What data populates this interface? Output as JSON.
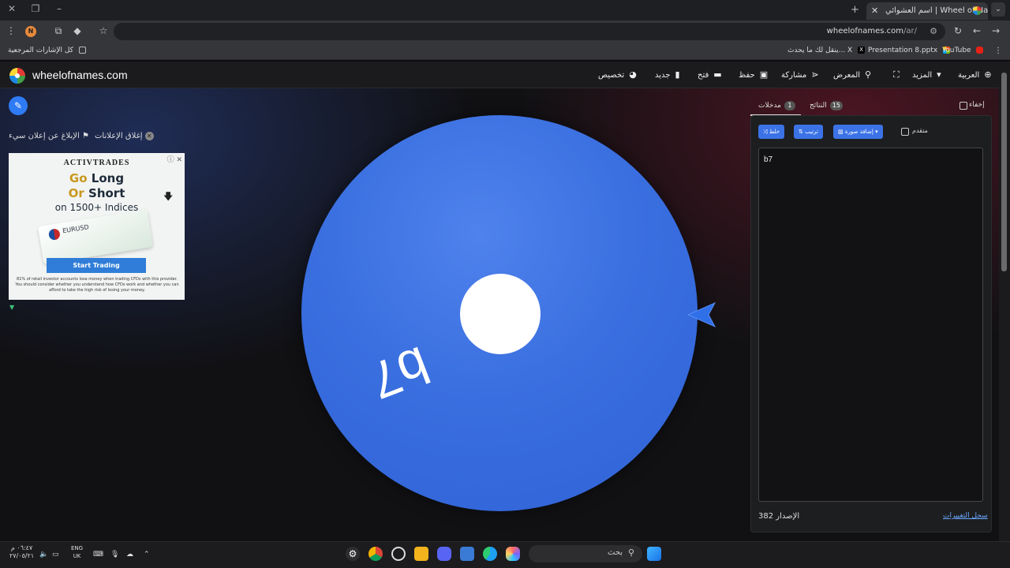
{
  "browser": {
    "tab_title": "اسم العشوائي | Wheel of Names",
    "url_host": "wheelofnames.com",
    "url_path": "/ar/",
    "profile_initial": "N",
    "bookmarks": {
      "all_bookmarks": "كل الإشارات المرجعية",
      "youtube": "YouTube",
      "presentation": "Presentation 8.pptx",
      "x_post": "ينقل لك ما يحدث... X"
    }
  },
  "app": {
    "site_name": "wheelofnames.com",
    "menu": {
      "customize": "تخصيص",
      "new": "جديد",
      "open": "فتح",
      "save": "حفظ",
      "share": "مشاركة",
      "gallery": "المعرض",
      "more": "المزيد",
      "language": "العربية"
    }
  },
  "ads": {
    "close_ads": "إغلاق الإعلانات",
    "report_ad": "الإبلاغ عن إعلان سيء",
    "banner": {
      "brand": "ACTIVTRADES",
      "line1_a": "Go",
      "line1_b": "Long",
      "line2_a": "Or",
      "line2_b": "Short",
      "line3": "on 1500+ Indices",
      "card_text": "EURUSD",
      "cta": "Start Trading",
      "disclaimer": "81% of retail investor accounts lose money when trading CFDs with this provider. You should consider whether you understand how CFDs work and whether you can afford to take the high risk of losing your money."
    }
  },
  "wheel": {
    "segment_label": "b7",
    "color": "#3a6fe0"
  },
  "panel": {
    "tab_entries": "مدخلات",
    "entries_count": "1",
    "tab_results": "النتائج",
    "results_count": "15",
    "hide_label": "إخفاء",
    "shuffle": "خلط",
    "sort": "ترتيب",
    "add_image": "إضافة صورة",
    "advanced": "متقدم",
    "entries": [
      "b7"
    ],
    "version_label": "الإصدار",
    "version_number": "382",
    "changelog": "سجل التغييرات"
  },
  "taskbar": {
    "search_label": "بحث",
    "lang_top": "ENG",
    "lang_bottom": "UK",
    "time": "٠٦:٤٧ م",
    "date": "٢٧/٠٥/٢١"
  }
}
